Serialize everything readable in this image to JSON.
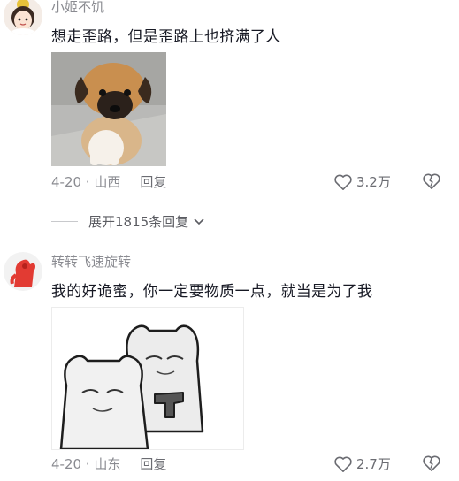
{
  "comments": [
    {
      "username": "小姬不饥",
      "text": "想走歪路，但是歪路上也挤满了人",
      "meta": "4-20 · 山西",
      "reply_label": "回复",
      "likes": "3.2万",
      "has_image": true
    },
    {
      "username": "转转飞速旋转",
      "text": "我的好诡蜜，你一定要物质一点，就当是为了我",
      "meta": "4-20 · 山东",
      "reply_label": "回复",
      "likes": "2.7万",
      "has_image": true
    }
  ],
  "expand_replies": "展开1815条回复",
  "icons": {
    "like": "heart-outline-icon",
    "dislike": "broken-heart-icon",
    "expand": "chevron-down-icon"
  },
  "colors": {
    "text": "#161823",
    "muted": "#8a8b91"
  }
}
